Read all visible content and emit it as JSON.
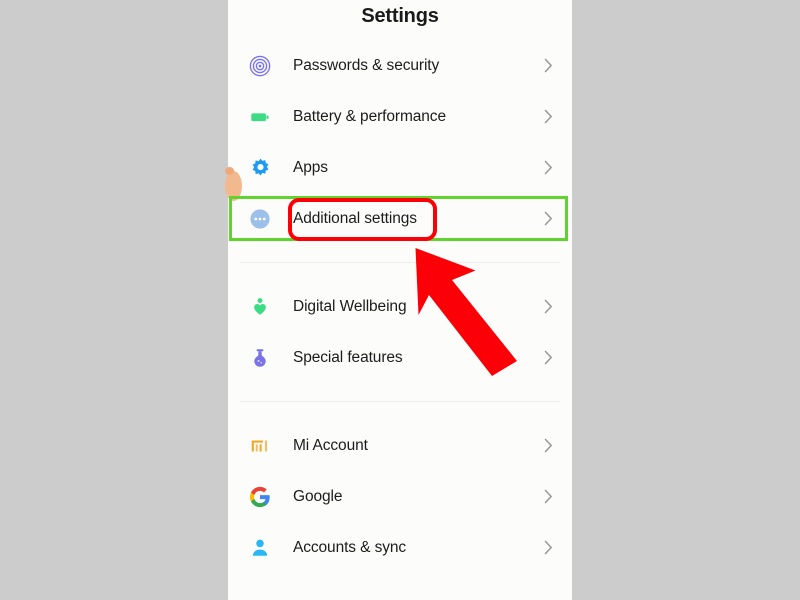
{
  "window": {
    "background_color": "#cccccc",
    "screen_background": "#fcfcfb"
  },
  "header": {
    "title": "Settings"
  },
  "annotations": {
    "green_box": {
      "color": "#5ed42c",
      "target": "Additional settings",
      "description": "green rectangle outlining the Additional settings row"
    },
    "red_box": {
      "color": "#fb0007",
      "target": "Additional settings",
      "description": "red rounded rectangle outlining the Additional settings label"
    },
    "red_arrow": {
      "color": "#fb0007",
      "direction": "up-left",
      "points_to": "Additional settings"
    },
    "finger": {
      "color": "#f3b98e",
      "description": "partially visible fingertip at left edge of screen"
    }
  },
  "settings": {
    "groups": [
      {
        "id": "group-1",
        "items": [
          {
            "label": "Passwords & security",
            "icon": "fingerprint-icon",
            "icon_color": "#7b72e9",
            "chevron": "chevron-right-icon"
          },
          {
            "label": "Battery & performance",
            "icon": "battery-icon",
            "icon_color": "#3ddc84",
            "chevron": "chevron-right-icon"
          },
          {
            "label": "Apps",
            "icon": "gear-icon",
            "icon_color": "#1e9bf0",
            "chevron": "chevron-right-icon"
          },
          {
            "label": "Additional settings",
            "icon": "more-dots-icon",
            "icon_color": "#9dc0ea",
            "chevron": "chevron-right-icon",
            "highlighted": true
          }
        ]
      },
      {
        "id": "group-2",
        "items": [
          {
            "label": "Digital Wellbeing",
            "icon": "wellbeing-heart-icon",
            "icon_color": "#3ddc84",
            "chevron": "chevron-right-icon"
          },
          {
            "label": "Special features",
            "icon": "flask-icon",
            "icon_color": "#7b72e9",
            "chevron": "chevron-right-icon"
          }
        ]
      },
      {
        "id": "group-3",
        "items": [
          {
            "label": "Mi Account",
            "icon": "mi-logo-icon",
            "icon_color": "#f5a623",
            "chevron": "chevron-right-icon"
          },
          {
            "label": "Google",
            "icon": "google-logo-icon",
            "icon_color": "#4285f4",
            "chevron": "chevron-right-icon"
          },
          {
            "label": "Accounts & sync",
            "icon": "person-icon",
            "icon_color": "#29b6f6",
            "chevron": "chevron-right-icon"
          }
        ]
      }
    ]
  }
}
